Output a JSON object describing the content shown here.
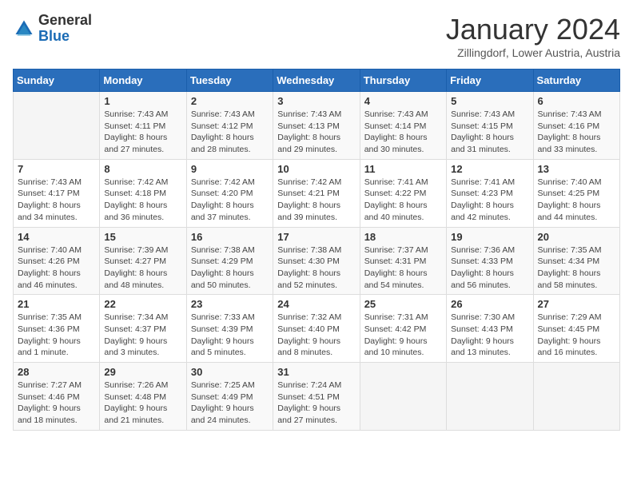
{
  "header": {
    "logo_line1": "General",
    "logo_line2": "Blue",
    "month": "January 2024",
    "location": "Zillingdorf, Lower Austria, Austria"
  },
  "weekdays": [
    "Sunday",
    "Monday",
    "Tuesday",
    "Wednesday",
    "Thursday",
    "Friday",
    "Saturday"
  ],
  "weeks": [
    [
      {
        "day": "",
        "sunrise": "",
        "sunset": "",
        "daylight": ""
      },
      {
        "day": "1",
        "sunrise": "Sunrise: 7:43 AM",
        "sunset": "Sunset: 4:11 PM",
        "daylight": "Daylight: 8 hours and 27 minutes."
      },
      {
        "day": "2",
        "sunrise": "Sunrise: 7:43 AM",
        "sunset": "Sunset: 4:12 PM",
        "daylight": "Daylight: 8 hours and 28 minutes."
      },
      {
        "day": "3",
        "sunrise": "Sunrise: 7:43 AM",
        "sunset": "Sunset: 4:13 PM",
        "daylight": "Daylight: 8 hours and 29 minutes."
      },
      {
        "day": "4",
        "sunrise": "Sunrise: 7:43 AM",
        "sunset": "Sunset: 4:14 PM",
        "daylight": "Daylight: 8 hours and 30 minutes."
      },
      {
        "day": "5",
        "sunrise": "Sunrise: 7:43 AM",
        "sunset": "Sunset: 4:15 PM",
        "daylight": "Daylight: 8 hours and 31 minutes."
      },
      {
        "day": "6",
        "sunrise": "Sunrise: 7:43 AM",
        "sunset": "Sunset: 4:16 PM",
        "daylight": "Daylight: 8 hours and 33 minutes."
      }
    ],
    [
      {
        "day": "7",
        "sunrise": "Sunrise: 7:43 AM",
        "sunset": "Sunset: 4:17 PM",
        "daylight": "Daylight: 8 hours and 34 minutes."
      },
      {
        "day": "8",
        "sunrise": "Sunrise: 7:42 AM",
        "sunset": "Sunset: 4:18 PM",
        "daylight": "Daylight: 8 hours and 36 minutes."
      },
      {
        "day": "9",
        "sunrise": "Sunrise: 7:42 AM",
        "sunset": "Sunset: 4:20 PM",
        "daylight": "Daylight: 8 hours and 37 minutes."
      },
      {
        "day": "10",
        "sunrise": "Sunrise: 7:42 AM",
        "sunset": "Sunset: 4:21 PM",
        "daylight": "Daylight: 8 hours and 39 minutes."
      },
      {
        "day": "11",
        "sunrise": "Sunrise: 7:41 AM",
        "sunset": "Sunset: 4:22 PM",
        "daylight": "Daylight: 8 hours and 40 minutes."
      },
      {
        "day": "12",
        "sunrise": "Sunrise: 7:41 AM",
        "sunset": "Sunset: 4:23 PM",
        "daylight": "Daylight: 8 hours and 42 minutes."
      },
      {
        "day": "13",
        "sunrise": "Sunrise: 7:40 AM",
        "sunset": "Sunset: 4:25 PM",
        "daylight": "Daylight: 8 hours and 44 minutes."
      }
    ],
    [
      {
        "day": "14",
        "sunrise": "Sunrise: 7:40 AM",
        "sunset": "Sunset: 4:26 PM",
        "daylight": "Daylight: 8 hours and 46 minutes."
      },
      {
        "day": "15",
        "sunrise": "Sunrise: 7:39 AM",
        "sunset": "Sunset: 4:27 PM",
        "daylight": "Daylight: 8 hours and 48 minutes."
      },
      {
        "day": "16",
        "sunrise": "Sunrise: 7:38 AM",
        "sunset": "Sunset: 4:29 PM",
        "daylight": "Daylight: 8 hours and 50 minutes."
      },
      {
        "day": "17",
        "sunrise": "Sunrise: 7:38 AM",
        "sunset": "Sunset: 4:30 PM",
        "daylight": "Daylight: 8 hours and 52 minutes."
      },
      {
        "day": "18",
        "sunrise": "Sunrise: 7:37 AM",
        "sunset": "Sunset: 4:31 PM",
        "daylight": "Daylight: 8 hours and 54 minutes."
      },
      {
        "day": "19",
        "sunrise": "Sunrise: 7:36 AM",
        "sunset": "Sunset: 4:33 PM",
        "daylight": "Daylight: 8 hours and 56 minutes."
      },
      {
        "day": "20",
        "sunrise": "Sunrise: 7:35 AM",
        "sunset": "Sunset: 4:34 PM",
        "daylight": "Daylight: 8 hours and 58 minutes."
      }
    ],
    [
      {
        "day": "21",
        "sunrise": "Sunrise: 7:35 AM",
        "sunset": "Sunset: 4:36 PM",
        "daylight": "Daylight: 9 hours and 1 minute."
      },
      {
        "day": "22",
        "sunrise": "Sunrise: 7:34 AM",
        "sunset": "Sunset: 4:37 PM",
        "daylight": "Daylight: 9 hours and 3 minutes."
      },
      {
        "day": "23",
        "sunrise": "Sunrise: 7:33 AM",
        "sunset": "Sunset: 4:39 PM",
        "daylight": "Daylight: 9 hours and 5 minutes."
      },
      {
        "day": "24",
        "sunrise": "Sunrise: 7:32 AM",
        "sunset": "Sunset: 4:40 PM",
        "daylight": "Daylight: 9 hours and 8 minutes."
      },
      {
        "day": "25",
        "sunrise": "Sunrise: 7:31 AM",
        "sunset": "Sunset: 4:42 PM",
        "daylight": "Daylight: 9 hours and 10 minutes."
      },
      {
        "day": "26",
        "sunrise": "Sunrise: 7:30 AM",
        "sunset": "Sunset: 4:43 PM",
        "daylight": "Daylight: 9 hours and 13 minutes."
      },
      {
        "day": "27",
        "sunrise": "Sunrise: 7:29 AM",
        "sunset": "Sunset: 4:45 PM",
        "daylight": "Daylight: 9 hours and 16 minutes."
      }
    ],
    [
      {
        "day": "28",
        "sunrise": "Sunrise: 7:27 AM",
        "sunset": "Sunset: 4:46 PM",
        "daylight": "Daylight: 9 hours and 18 minutes."
      },
      {
        "day": "29",
        "sunrise": "Sunrise: 7:26 AM",
        "sunset": "Sunset: 4:48 PM",
        "daylight": "Daylight: 9 hours and 21 minutes."
      },
      {
        "day": "30",
        "sunrise": "Sunrise: 7:25 AM",
        "sunset": "Sunset: 4:49 PM",
        "daylight": "Daylight: 9 hours and 24 minutes."
      },
      {
        "day": "31",
        "sunrise": "Sunrise: 7:24 AM",
        "sunset": "Sunset: 4:51 PM",
        "daylight": "Daylight: 9 hours and 27 minutes."
      },
      {
        "day": "",
        "sunrise": "",
        "sunset": "",
        "daylight": ""
      },
      {
        "day": "",
        "sunrise": "",
        "sunset": "",
        "daylight": ""
      },
      {
        "day": "",
        "sunrise": "",
        "sunset": "",
        "daylight": ""
      }
    ]
  ]
}
